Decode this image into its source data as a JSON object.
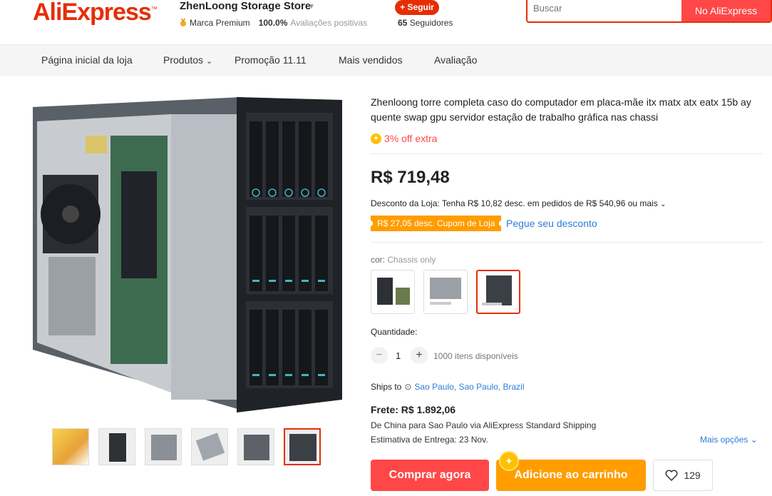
{
  "header": {
    "logo": "AliExpress",
    "store_name": "ZhenLoong Storage Store",
    "brand_badge": "Marca Premium",
    "positive_rate": "100.0%",
    "positive_label": "Avaliações positivas",
    "follow_label": "+ Seguir",
    "followers_count": "65",
    "followers_label": "Seguidores",
    "search_placeholder": "Buscar",
    "search_button": "No AliExpress"
  },
  "nav": {
    "items": [
      "Página inicial da loja",
      "Produtos",
      "Promoção 11.11",
      "Mais vendidos",
      "Avaliação"
    ]
  },
  "product": {
    "title": "Zhenloong torre completa caso do computador em placa-mãe itx matx atx eatx 15b ay quente swap gpu servidor estação de trabalho gráfica nas chassi",
    "extra_off": "3% off extra",
    "price": "R$ 719,48",
    "store_discount": "Desconto da Loja: Tenha R$ 10,82 desc. em pedidos de R$ 540,96 ou mais",
    "coupon_tag": "R$ 27,05 desc. Cupom de Loja",
    "get_coupon": "Pegue seu desconto",
    "color_label": "cor:",
    "color_value": "Chassis only",
    "quantity_label": "Quantidade:",
    "quantity_value": "1",
    "quantity_available": "1000 itens disponíveis",
    "ships_to_label": "Ships to",
    "ships_to_location": "Sao Paulo, Sao Paulo, Brazil",
    "freight": "Frete: R$ 1.892,06",
    "ship_detail_prefix": "De China para",
    "ship_detail_city": "Sao Paulo",
    "ship_detail_suffix": "via AliExpress Standard Shipping",
    "eta": "Estimativa de Entrega: 23 Nov.",
    "more_options": "Mais opções",
    "buy_now": "Comprar agora",
    "add_to_cart": "Adicione ao carrinho",
    "wishlist_count": "129"
  },
  "colors": {
    "brand": "#e62e04",
    "buy": "#ff4747",
    "cart": "#ff9d00",
    "link": "#2e7dd7"
  }
}
